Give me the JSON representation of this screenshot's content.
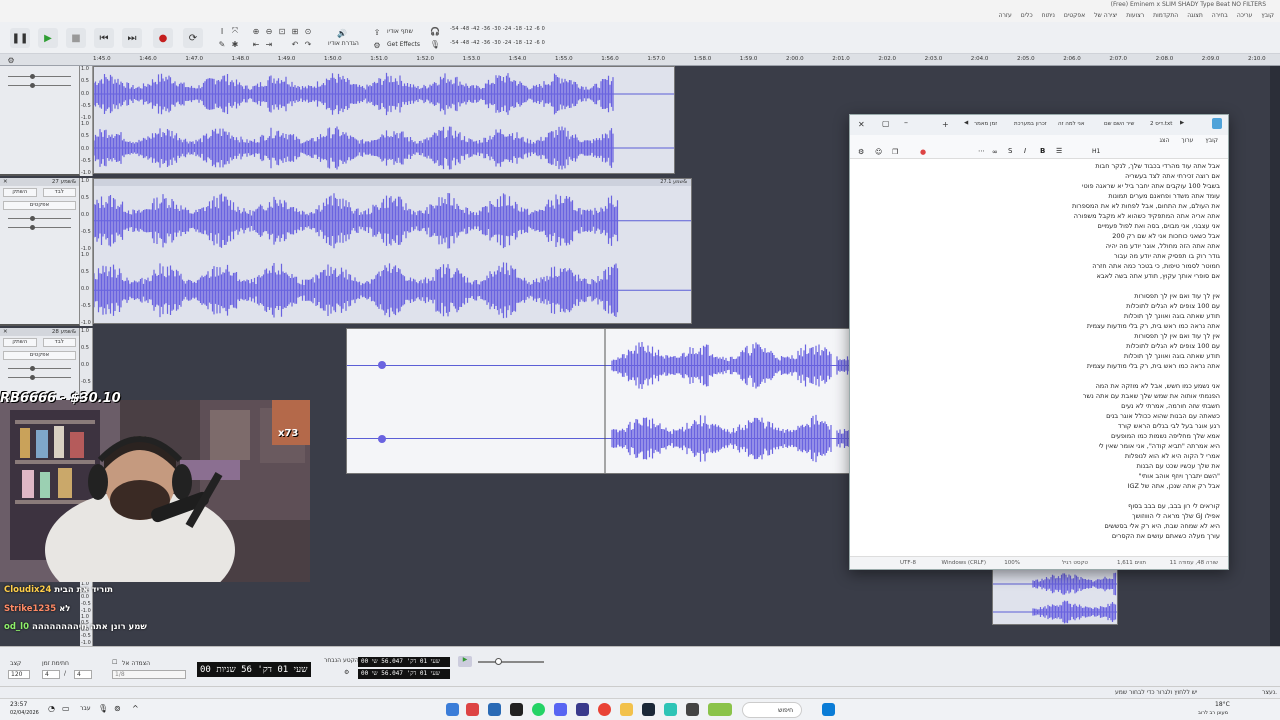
{
  "window": {
    "title": "(Free) Eminem x SLIM SHADY Type Beat  NO FILTERS",
    "menu": [
      "קובץ",
      "עריכה",
      "בחירה",
      "תצוגה",
      "התקדמות",
      "רצועות",
      "יצירה של",
      "אפקטים",
      "ניתוח",
      "כלים",
      "עזרה"
    ]
  },
  "toolbar": {
    "share_audio_label": "שתף אודיו",
    "get_effects_label": "Get Effects",
    "audio_setup_label": "הגדרת אודיו",
    "meter_play": "-54 -48 -42 -36 -30 -24 -18 -12 -6 0",
    "meter_rec": "-54 -48 -42 -36 -30 -24 -18 -12 -6 0"
  },
  "ruler": {
    "ticks": [
      "1:45.0",
      "1:46.0",
      "1:47.0",
      "1:48.0",
      "1:49.0",
      "1:50.0",
      "1:51.0",
      "1:52.0",
      "1:53.0",
      "1:54.0",
      "1:55.0",
      "1:56.0",
      "1:57.0",
      "1:58.0",
      "1:59.0",
      "2:00.0",
      "2:01.0",
      "2:02.0",
      "2:03.0",
      "2:04.0",
      "2:05.0",
      "2:06.0",
      "2:07.0",
      "2:08.0",
      "2:09.0",
      "2:10.0"
    ]
  },
  "tracks": [
    {
      "name": "",
      "mute": "השתק",
      "solo": "לבד",
      "effects": "אפקטים"
    },
    {
      "name": "שמע 27&",
      "mute": "השתק",
      "solo": "לבד",
      "effects": "אפקטים",
      "clip_label": "שמע 27.1&"
    },
    {
      "name": "שמע 28&",
      "mute": "השתק",
      "solo": "לבד",
      "effects": "אפקטים"
    }
  ],
  "scale_labels": [
    "1.0",
    "0.5",
    "0.0",
    "-0.5",
    "-1.0"
  ],
  "notepad": {
    "tabs": [
      "דיס 2.txt",
      "שיר השם שם",
      "אני למה זה",
      "זכרון במערכת",
      "זמן מאמר"
    ],
    "menu": [
      "קובץ",
      "ערוך",
      "הצג"
    ],
    "heading_btn": "H1",
    "lines": [
      "אבל אתה עוד מהרדי בכבוד שלך, לנקר חבות",
      "אם רוצה זכירתי אתה לצד בעשריה",
      "בשביל 100 עוקבים אתה יחבר ביל יא שראגה פוטי",
      "עומד אתה משדר ופחאנם מערים תמונות",
      "את העולם, את התחום, אבל לפחות לא את המספרות",
      "אתה אריה אתה המתפקיד כשהוא לא מקבל משפורה",
      "אני עצבני, אני מבוים, בסה ואת לפול פעמיים",
      "אבל כשאני כוחכות אני לא שם רק 200",
      "אתה אתה הזה מחולל, אוגר יודע מה יהיה",
      "גודר רוק בו תפסיק אתה יודע מה עבור",
      "חמוטר לסמור טיפות, כי בטכר כמה אתה חזרה",
      "אם סופרי אותך עקוץ, תודע אתה בשה לאבא",
      "",
      "אין לך עוד ואם אין לך תפסורות",
      "עם 100 צופים לא הגלים לתוכלות",
      "תודע שאתה בוגה ואוונך לך תוכלות",
      "אתה נראה כמו ראש בית, רק בלי מודעות עצמית",
      "אין לך עוד ואם אין לך תפסורות",
      "עם 100 צופים לא הגלים לתוכלות",
      "תודע שאתה בוגה ואוונך לך תוכלות",
      "אתה נראה כמו ראש בית, רק בלי מודעות עצמית",
      "",
      "אני נשמע כמו חשש, אבל לא מוזקה את המה",
      "הפנמתי אותוה את שמש שלך שאבת עם אתה נשר",
      "חשבתי שזה חורמה, אמרתי לא נעים",
      "כשאתה עם הבנות שהוא ככולל אוגר בנים",
      "רגע אוגר בעל לבי בגלים הראש קורד",
      "אמא שלך מחליפה נשמות כמו המופעים",
      "היא אמרתה \"תביא קודה\", אני אומר שאין לי",
      "אמרי ל הקוה היא לא הוא לנופלות",
      "את שלך עכשיו שכט עם הבנות",
      "\"השם יתברך ויוזף אוהב אותי\"",
      "אבל רק אתה שנכן, אתה של IGZ",
      "",
      "קוראים לי רון בבב, עם בבב בסוף",
      "אפילו GJ שלך מראה לי הוווזושך",
      "היא לא שמחה שבת, היא רק אלי בסששים",
      "עורך מעלה כשאתם עושים את הקסרים"
    ],
    "status": {
      "position": "שורה 48, עמודה 11",
      "chars": "1,611 תווים",
      "mode": "טקסט רגיל",
      "zoom": "100%",
      "eol": "Windows (CRLF)",
      "encoding": "UTF-8"
    }
  },
  "stream": {
    "donation": "RB6666 - $30.10",
    "chat": [
      {
        "user": "Cloudix24",
        "text": "תוריד את הבית",
        "color": "#ffcf4a"
      },
      {
        "user": "Strike1235",
        "text": "לא",
        "color": "#ff8a65"
      },
      {
        "user": "od_l0",
        "text": "שמע רונן אתה חיהההההההה",
        "color": "#8ef06a"
      }
    ],
    "badge": "x73"
  },
  "bottom": {
    "tempo_label": "קצב",
    "tempo_value": "120",
    "timesig_label": "חתימת זמן",
    "timesig_num": "4",
    "timesig_den": "4",
    "snap_label": "הצמדה אל",
    "snap_value": "1/8",
    "time_display": "00 שעי 01 דק' 56 שניות",
    "sel_label": "הקטע הנבחר",
    "sel_start": "00 שעי 01 דק' 56.047 שי",
    "sel_end": "00 שעי 01 דק' 56.047 שי",
    "status_text": "יש ללחוץ ולגרור כדי לבחור שמע",
    "status_right": "נעצר."
  },
  "taskbar": {
    "time": "23:57",
    "date": "02/04/2026",
    "search": "חיפוש",
    "weather": "18°C",
    "weather_desc": "מעונן רב לרוב"
  }
}
